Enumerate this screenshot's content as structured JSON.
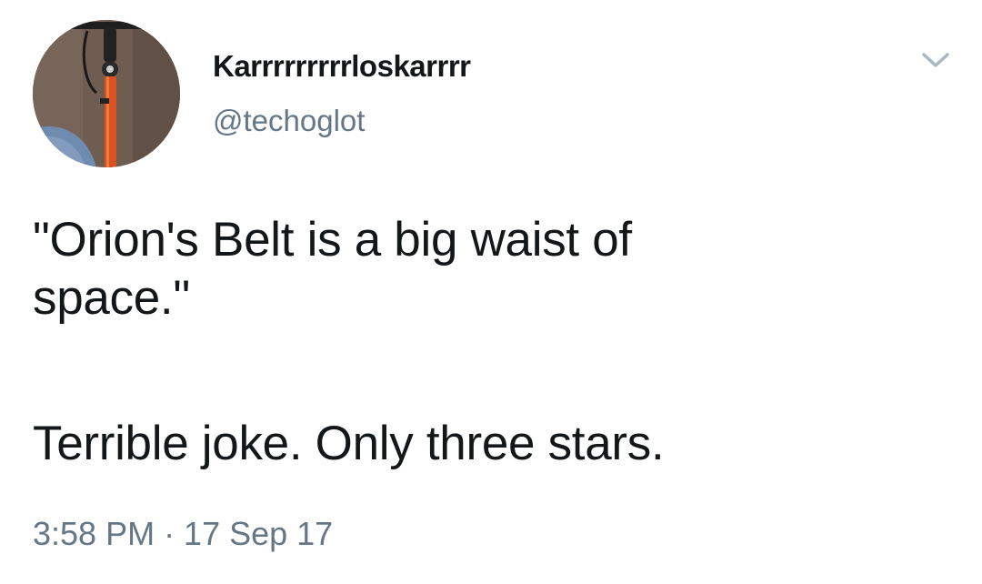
{
  "author": {
    "display_name": "Karrrrrrrrrloskarrrr",
    "handle": "@techoglot",
    "avatar_icon": "bicycle-photo"
  },
  "tweet": {
    "line1": "\"Orion's Belt is a big waist of",
    "line2": "space.\"",
    "line3": "Terrible joke. Only three stars.",
    "timestamp": "3:58 PM · 17 Sep 17"
  },
  "colors": {
    "text_primary": "#14171a",
    "text_secondary": "#657786",
    "chevron": "#aab8c2"
  }
}
